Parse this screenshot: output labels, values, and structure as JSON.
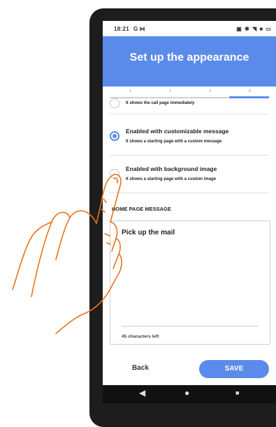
{
  "status_bar": {
    "time": "18:21",
    "left_icons": "G ⋈",
    "right_icons": "▣ ✱ ◥ ■ ▭"
  },
  "header": {
    "title": "Set up the appearance"
  },
  "stepper": {
    "steps": [
      "1",
      "2",
      "3",
      "4"
    ],
    "active_step": 4
  },
  "options": [
    {
      "title": "",
      "subtitle": "It shows the call page immediately",
      "selected": false
    },
    {
      "title": "Enabled with customizable message",
      "subtitle": "It shows a starting page with a custom message",
      "selected": true
    },
    {
      "title": "Enabled with background image",
      "subtitle": "It shows a starting page with a custom image",
      "selected": false
    }
  ],
  "home_message": {
    "label": "HOME PAGE MESSAGE",
    "value": "Pick up the mail",
    "chars_left": "45 characters left"
  },
  "footer": {
    "back_label": "Back",
    "save_label": "SAVE"
  },
  "nav": {
    "back": "◀",
    "home": "●",
    "recent": "■"
  },
  "colors": {
    "accent": "#5b8bea",
    "hand_stroke": "#e8731a"
  }
}
